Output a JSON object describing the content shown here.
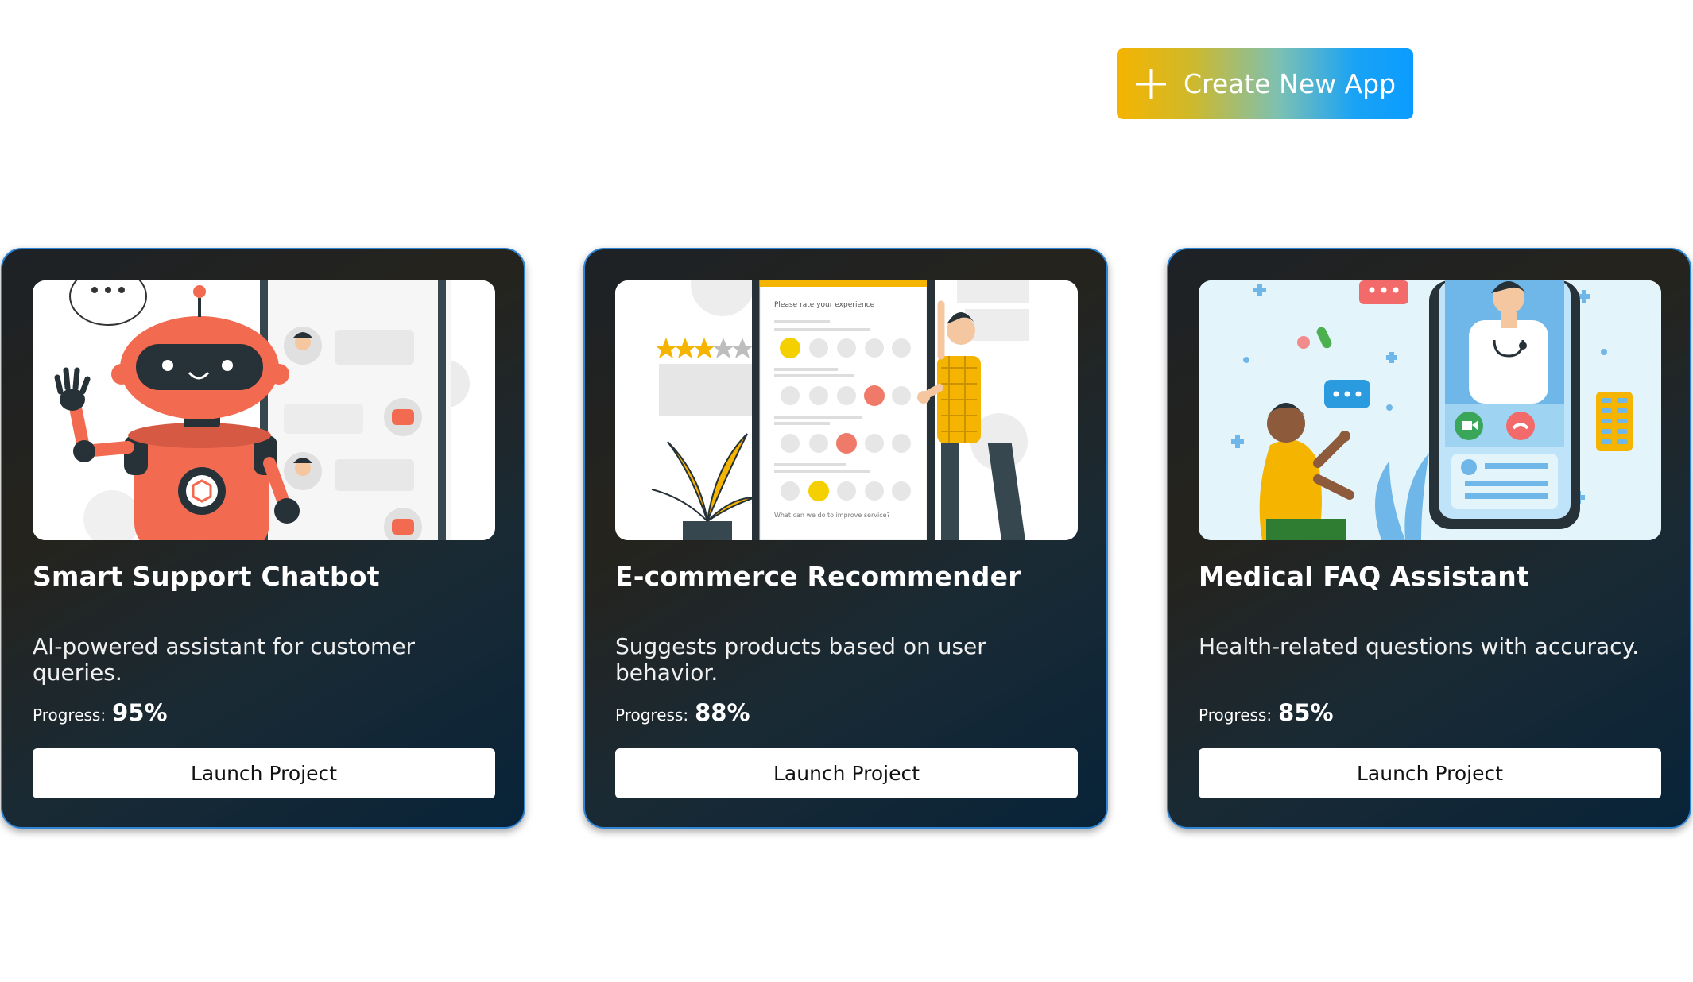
{
  "header": {
    "create_label": "Create New App",
    "create_gradient": [
      "#f5b400",
      "#1aa3f5"
    ]
  },
  "theme": {
    "card_border": "#2f86d6",
    "card_background": "#1d2226",
    "text": "#ffffff",
    "button_bg": "#ffffff",
    "button_text": "#111111"
  },
  "projects": [
    {
      "title": "Smart Support Chatbot",
      "description": "AI-powered assistant for customer queries.",
      "progress_label": "Progress:",
      "progress_value": "95%",
      "button_label": "Launch Project",
      "illustration": "robot-chat-illustration"
    },
    {
      "title": "E-commerce Recommender",
      "description": "Suggests products based on user behavior.",
      "progress_label": "Progress:",
      "progress_value": "88%",
      "button_label": "Launch Project",
      "illustration": "rating-survey-illustration",
      "survey_prompt": "Please rate your experience",
      "survey_question": "What can we do to improve service?"
    },
    {
      "title": "Medical FAQ Assistant",
      "description": "Health-related questions with accuracy.",
      "progress_label": "Progress:",
      "progress_value": "85%",
      "button_label": "Launch Project",
      "illustration": "telemedicine-illustration"
    }
  ]
}
